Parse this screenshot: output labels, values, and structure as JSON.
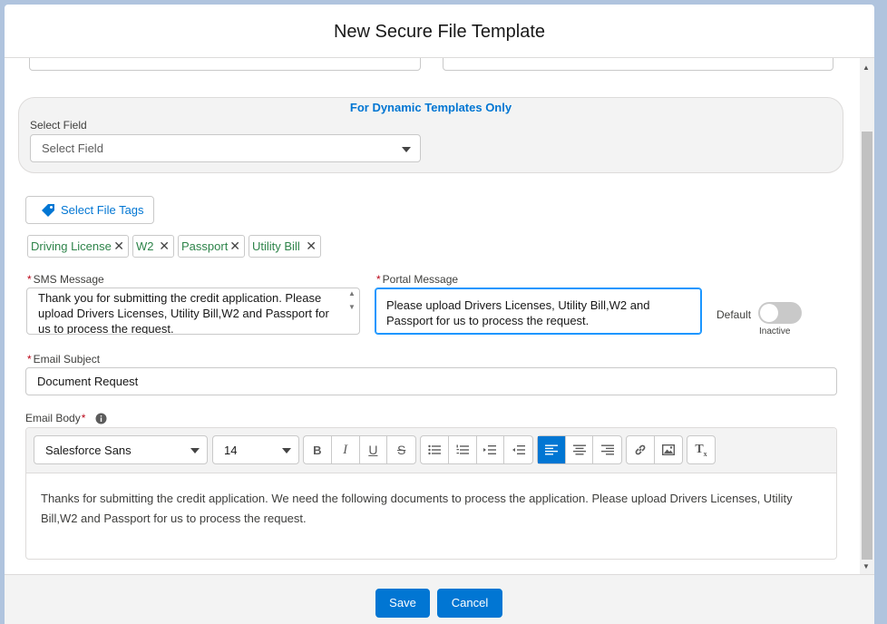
{
  "modal": {
    "title": "New Secure File Template"
  },
  "dynamic_section": {
    "title": "For Dynamic Templates Only",
    "select_field_label": "Select Field",
    "select_field_placeholder": "Select Field"
  },
  "file_tags": {
    "button_label": "Select File Tags",
    "tags": [
      "Driving License",
      "W2",
      "Passport",
      "Utility Bill"
    ],
    "remove_glyph": "✕"
  },
  "sms": {
    "label": "SMS Message",
    "required_mark": "*",
    "value": "Thank you for submitting the credit application. Please upload Drivers Licenses, Utility Bill,W2 and Passport for us to process the request."
  },
  "portal": {
    "label": "Portal Message",
    "required_mark": "*",
    "value": "Please upload Drivers Licenses, Utility Bill,W2 and Passport for us to process the request."
  },
  "default_toggle": {
    "label": "Default",
    "state_text": "Inactive",
    "checked": false
  },
  "email_subject": {
    "label": "Email Subject",
    "required_mark": "*",
    "value": "Document Request"
  },
  "email_body": {
    "label": "Email Body",
    "required_mark": "*",
    "font_family": "Salesforce Sans",
    "font_size": "14",
    "value": "Thanks for submitting the credit application. We need the following documents to process the application. Please upload Drivers Licenses, Utility Bill,W2 and Passport for us to process the request."
  },
  "toolbar_icons": [
    "bold-icon",
    "italic-icon",
    "underline-icon",
    "strikethrough-icon",
    "bullet-list-icon",
    "numbered-list-icon",
    "indent-icon",
    "outdent-icon",
    "align-left-icon",
    "align-center-icon",
    "align-right-icon",
    "link-icon",
    "image-icon",
    "clear-format-icon"
  ],
  "footer": {
    "save_label": "Save",
    "cancel_label": "Cancel"
  },
  "colors": {
    "brand": "#0176d3",
    "tag_text": "#2e844a",
    "required": "#ba0517"
  }
}
